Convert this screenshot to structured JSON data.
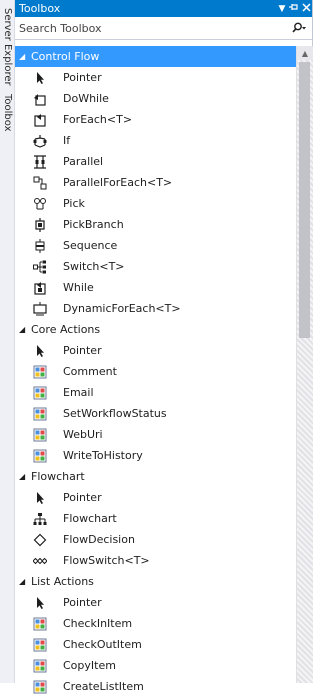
{
  "side_tabs": [
    "Server Explorer",
    "Toolbox"
  ],
  "window": {
    "title": "Toolbox"
  },
  "search": {
    "placeholder": "Search Toolbox"
  },
  "groups": [
    {
      "name": "Control Flow",
      "selected": true,
      "items": [
        {
          "label": "Pointer",
          "icon": "pointer-icon"
        },
        {
          "label": "DoWhile",
          "icon": "dowhile-icon"
        },
        {
          "label": "ForEach<T>",
          "icon": "foreach-icon"
        },
        {
          "label": "If",
          "icon": "if-icon"
        },
        {
          "label": "Parallel",
          "icon": "parallel-icon"
        },
        {
          "label": "ParallelForEach<T>",
          "icon": "parallel-foreach-icon"
        },
        {
          "label": "Pick",
          "icon": "pick-icon"
        },
        {
          "label": "PickBranch",
          "icon": "pickbranch-icon"
        },
        {
          "label": "Sequence",
          "icon": "sequence-icon"
        },
        {
          "label": "Switch<T>",
          "icon": "switch-icon"
        },
        {
          "label": "While",
          "icon": "while-icon"
        },
        {
          "label": "DynamicForEach<T>",
          "icon": "dynamic-foreach-icon"
        }
      ]
    },
    {
      "name": "Core Actions",
      "selected": false,
      "items": [
        {
          "label": "Pointer",
          "icon": "pointer-icon"
        },
        {
          "label": "Comment",
          "icon": "activity-icon"
        },
        {
          "label": "Email",
          "icon": "activity-icon"
        },
        {
          "label": "SetWorkflowStatus",
          "icon": "activity-icon"
        },
        {
          "label": "WebUri",
          "icon": "activity-icon"
        },
        {
          "label": "WriteToHistory",
          "icon": "activity-icon"
        }
      ]
    },
    {
      "name": "Flowchart",
      "selected": false,
      "items": [
        {
          "label": "Pointer",
          "icon": "pointer-icon"
        },
        {
          "label": "Flowchart",
          "icon": "flowchart-icon"
        },
        {
          "label": "FlowDecision",
          "icon": "flowdecision-icon"
        },
        {
          "label": "FlowSwitch<T>",
          "icon": "flowswitch-icon"
        }
      ]
    },
    {
      "name": "List Actions",
      "selected": false,
      "items": [
        {
          "label": "Pointer",
          "icon": "pointer-icon"
        },
        {
          "label": "CheckInItem",
          "icon": "activity-icon"
        },
        {
          "label": "CheckOutItem",
          "icon": "activity-icon"
        },
        {
          "label": "CopyItem",
          "icon": "activity-icon"
        },
        {
          "label": "CreateListItem",
          "icon": "activity-icon"
        }
      ]
    }
  ],
  "colors": {
    "titlebar": "#007acc",
    "selection": "#3399ff"
  }
}
